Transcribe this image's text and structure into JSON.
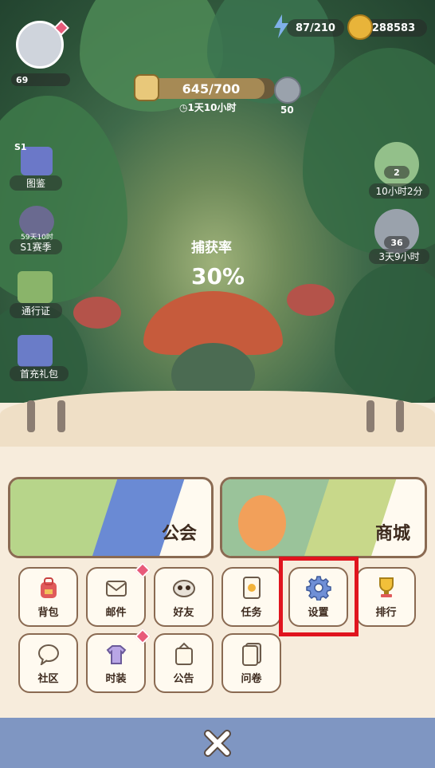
{
  "top_bar": {
    "avatar_level": "69",
    "energy": "87/210",
    "coins": "288583"
  },
  "progress": {
    "value": "645/700",
    "timer": "1天10小时",
    "token_count": "50"
  },
  "left_menu": [
    {
      "label": "图鉴",
      "badge": "S1"
    },
    {
      "label": "S1赛季",
      "sub": "59天10时"
    },
    {
      "label": "通行证"
    },
    {
      "label": "首充礼包"
    }
  ],
  "right_menu": [
    {
      "count": "2",
      "timer": "10小时2分"
    },
    {
      "count": "36",
      "timer": "3天9小时"
    }
  ],
  "capture": {
    "label": "捕获率",
    "rate": "30%"
  },
  "cards": {
    "guild": "公会",
    "shop": "商城"
  },
  "menu_row1": [
    {
      "label": "背包",
      "icon": "backpack-icon"
    },
    {
      "label": "邮件",
      "icon": "mail-icon"
    },
    {
      "label": "好友",
      "icon": "friends-icon"
    },
    {
      "label": "任务",
      "icon": "task-icon"
    },
    {
      "label": "设置",
      "icon": "gear-icon"
    },
    {
      "label": "排行",
      "icon": "trophy-icon"
    }
  ],
  "menu_row2": [
    {
      "label": "社区",
      "icon": "community-icon"
    },
    {
      "label": "时装",
      "icon": "outfit-icon"
    },
    {
      "label": "公告",
      "icon": "announcement-icon"
    },
    {
      "label": "问卷",
      "icon": "survey-icon"
    }
  ],
  "colors": {
    "highlight": "#e0141e",
    "panel": "#f7ecdc",
    "bottom_bar": "#7f96c2"
  }
}
